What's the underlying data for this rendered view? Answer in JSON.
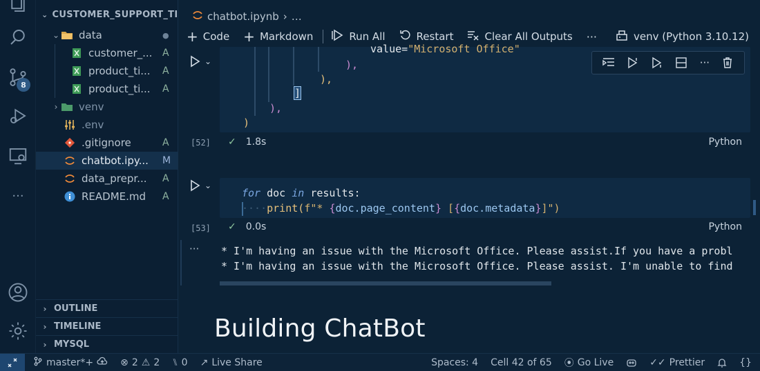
{
  "explorer": {
    "title": "CUSTOMER_SUPPORT_TI...",
    "items": [
      {
        "name": "data",
        "status": "",
        "dot": "●"
      },
      {
        "name": "customer_...",
        "status": "A"
      },
      {
        "name": "product_ti...",
        "status": "A"
      },
      {
        "name": "product_ti...",
        "status": "A"
      },
      {
        "name": "venv",
        "status": ""
      },
      {
        "name": ".env",
        "status": ""
      },
      {
        "name": ".gitignore",
        "status": "A"
      },
      {
        "name": "chatbot.ipy...",
        "status": "M"
      },
      {
        "name": "data_prepr...",
        "status": "A"
      },
      {
        "name": "README.md",
        "status": "A"
      }
    ],
    "sections": [
      "OUTLINE",
      "TIMELINE",
      "MYSQL"
    ]
  },
  "activity": {
    "badge": "8",
    "more": "···"
  },
  "breadcrumb": {
    "file": "chatbot.ipynb",
    "ellipsis": "…"
  },
  "toolbar": {
    "code": "Code",
    "markdown": "Markdown",
    "run_all": "Run All",
    "restart": "Restart",
    "clear_all": "Clear All Outputs",
    "more": "···",
    "kernel": "venv (Python 3.10.12)"
  },
  "cells": [
    {
      "exec": "[52]",
      "time": "1.8s",
      "lang": "Python",
      "lines": {
        "l1_a": "value=",
        "l1_b": "\"Microsoft Office\"",
        "l2": "),",
        "l3": "),",
        "l4": "]",
        "l5": "),",
        "l6": ")"
      }
    },
    {
      "exec": "[53]",
      "time": "0.0s",
      "lang": "Python",
      "lines": {
        "for": "for",
        "doc": " doc ",
        "in": "in",
        "results": " results:",
        "dots": "····",
        "print": "print",
        "open": "(",
        "fstr": "f\"* ",
        "b1o": "{",
        "pc": "doc.page_content",
        "b1c": "}",
        "sp": " [",
        "b2o": "{",
        "md": "doc.metadata",
        "b2c": "}",
        "close": "]\")"
      }
    }
  ],
  "output": {
    "more": "···",
    "line1": "* I'm having an issue with the Microsoft Office. Please assist.If you have a probl",
    "line2": "* I'm having an issue with the Microsoft Office. Please assist. I'm unable to find"
  },
  "overlay_heading": "Building ChatBot",
  "statusbar": {
    "branch": "master*+",
    "errors": "2",
    "warnings": "2",
    "ports": "0",
    "liveshare": "Live Share",
    "spaces": "Spaces: 4",
    "cell": "Cell 42 of 65",
    "golive": "Go Live",
    "prettier": "Prettier",
    "braces": "{}"
  }
}
